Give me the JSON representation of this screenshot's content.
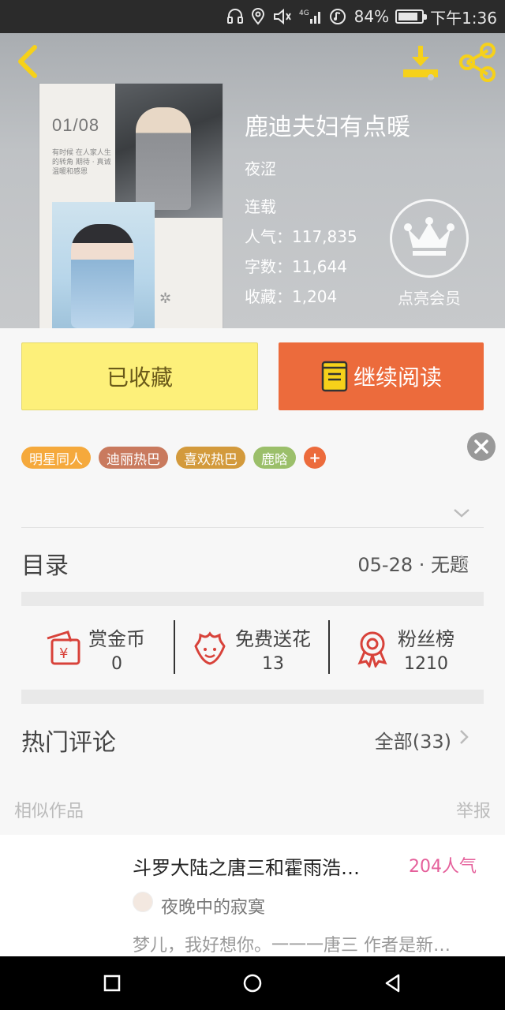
{
  "status_bar": {
    "battery_percent": "84%",
    "battery_level": 0.84,
    "time": "下午1:36"
  },
  "book": {
    "title": "鹿迪夫妇有点暖",
    "author": "夜涩",
    "status": "连载",
    "popularity_label": "人气：",
    "popularity": "117,835",
    "words_label": "字数：",
    "words": "11,644",
    "favorites_label": "收藏：",
    "favorites": "1,204",
    "cover": {
      "date_text": "01/08",
      "caption": "有时候 在人家人生的转角 期待 · 真诚 温暖和感恩"
    },
    "vip_label": "点亮会员"
  },
  "actions": {
    "collected_label": "已收藏",
    "read_label": "继续阅读"
  },
  "tags": [
    {
      "label": "明星同人",
      "color": "#f5a93c"
    },
    {
      "label": "迪丽热巴",
      "color": "#c97a5e"
    },
    {
      "label": "喜欢热巴",
      "color": "#d39a3c"
    },
    {
      "label": "鹿晗",
      "color": "#9bbf6a"
    }
  ],
  "tag_add_label": "+",
  "catalog": {
    "title": "目录",
    "latest": "05-28 · 无题"
  },
  "stats": {
    "reward": {
      "name": "赏金币",
      "value": "0"
    },
    "flowers": {
      "name": "免费送花",
      "value": "13"
    },
    "fans": {
      "name": "粉丝榜",
      "value": "1210"
    }
  },
  "comments": {
    "title": "热门评论",
    "all_label": "全部(33)"
  },
  "similar": {
    "title": "相似作品",
    "report": "举报",
    "items": [
      {
        "title": "斗罗大陆之唐三和霍雨浩…",
        "popularity": "204人气",
        "author": "夜晚中的寂寞",
        "description": "梦儿，我好想你。一一一唐三 作者是新…"
      }
    ]
  },
  "colors": {
    "accent": "#ec6b3c",
    "collected_bg": "#fdf07a",
    "icon_yellow": "#f6d11a",
    "icon_red": "#d8423a",
    "popularity_pink": "#e5609b"
  }
}
